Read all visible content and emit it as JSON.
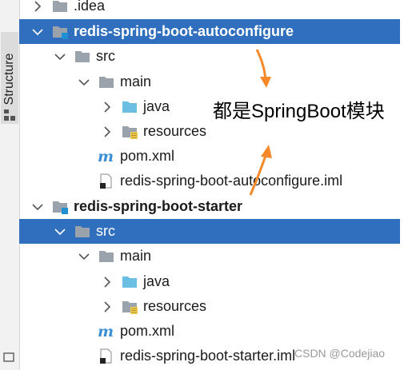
{
  "side_panel": {
    "tab_label": "Structure",
    "icon": "structure-icon"
  },
  "tree": [
    {
      "label": ".idea",
      "icon": "folder-gray-icon",
      "chevron": "right",
      "selected": false,
      "bold": false
    },
    {
      "label": "redis-spring-boot-autoconfigure",
      "icon": "module-folder-icon",
      "chevron": "down",
      "selected": true,
      "bold": true
    },
    {
      "label": "src",
      "icon": "folder-gray-icon",
      "chevron": "down",
      "selected": false,
      "bold": false
    },
    {
      "label": "main",
      "icon": "folder-gray-icon",
      "chevron": "down",
      "selected": false,
      "bold": false
    },
    {
      "label": "java",
      "icon": "folder-blue-icon",
      "chevron": "right",
      "selected": false,
      "bold": false
    },
    {
      "label": "resources",
      "icon": "resources-folder-icon",
      "chevron": "right",
      "selected": false,
      "bold": false
    },
    {
      "label": "pom.xml",
      "icon": "maven-icon",
      "chevron": "none",
      "selected": false,
      "bold": false
    },
    {
      "label": "redis-spring-boot-autoconfigure.iml",
      "icon": "iml-file-icon",
      "chevron": "none",
      "selected": false,
      "bold": false
    },
    {
      "label": "redis-spring-boot-starter",
      "icon": "module-folder-icon",
      "chevron": "down",
      "selected": false,
      "bold": true
    },
    {
      "label": "src",
      "icon": "folder-gray-icon",
      "chevron": "down",
      "selected": true,
      "bold": false
    },
    {
      "label": "main",
      "icon": "folder-gray-icon",
      "chevron": "down",
      "selected": false,
      "bold": false
    },
    {
      "label": "java",
      "icon": "folder-blue-icon",
      "chevron": "right",
      "selected": false,
      "bold": false
    },
    {
      "label": "resources",
      "icon": "resources-folder-icon",
      "chevron": "right",
      "selected": false,
      "bold": false
    },
    {
      "label": "pom.xml",
      "icon": "maven-icon",
      "chevron": "none",
      "selected": false,
      "bold": false
    },
    {
      "label": "redis-spring-boot-starter.iml",
      "icon": "iml-file-icon",
      "chevron": "none",
      "selected": false,
      "bold": false
    }
  ],
  "annotation": {
    "text": "都是SpringBoot模块",
    "arrow_color": "#f5892a"
  },
  "watermark": "CSDN @Codejiao",
  "colors": {
    "selection": "#2f6fbd",
    "folder": "#9aa3ab",
    "java_folder": "#6bbfe3",
    "module_mark": "#1e8fd0",
    "maven": "#3a8fd6"
  }
}
